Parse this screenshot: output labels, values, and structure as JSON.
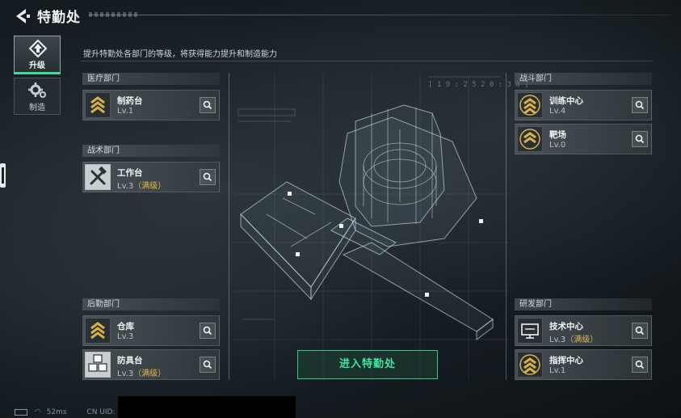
{
  "header": {
    "title": "特勤处",
    "back_icon": "back-arrow-icon"
  },
  "tabs": [
    {
      "label": "升级",
      "icon": "upgrade-icon",
      "active": true
    },
    {
      "label": "制造",
      "icon": "gear-icon",
      "active": false
    }
  ],
  "description": "提升特勤处各部门的等级，将获得能力提升和制造能力",
  "departments": {
    "medical": {
      "title": "医疗部门",
      "items": [
        {
          "name": "制药台",
          "level": "Lv.1",
          "max": "",
          "icon": "chevron-rank-icon"
        }
      ]
    },
    "tactical": {
      "title": "战术部门",
      "items": [
        {
          "name": "工作台",
          "level": "Lv.3",
          "max": "（满级）",
          "icon": "tools-icon"
        }
      ]
    },
    "logistics": {
      "title": "后勤部门",
      "items": [
        {
          "name": "仓库",
          "level": "Lv.3",
          "max": "",
          "icon": "chevron-rank-icon"
        },
        {
          "name": "防具台",
          "level": "Lv.3",
          "max": "（满级）",
          "icon": "cubes-icon"
        }
      ]
    },
    "combat": {
      "title": "战斗部门",
      "items": [
        {
          "name": "训练中心",
          "level": "Lv.4",
          "max": "",
          "icon": "chevron-rank-icon"
        },
        {
          "name": "靶场",
          "level": "Lv.0",
          "max": "",
          "icon": "chevron-rank-icon"
        }
      ]
    },
    "research": {
      "title": "研发部门",
      "items": [
        {
          "name": "技术中心",
          "level": "Lv.3",
          "max": "（满级）",
          "icon": "monitor-icon"
        },
        {
          "name": "指挥中心",
          "level": "Lv.1",
          "max": "",
          "icon": "chevron-rank-icon"
        }
      ]
    }
  },
  "enter_button": "进入特勤处",
  "status": {
    "ping": "52ms",
    "uid_label": "CN UID:"
  },
  "hud_text": {
    "clock": "[ 1 9 : 2 5   2 0 : 3 8 ]"
  },
  "colors": {
    "accent": "#3ddc97",
    "max_level": "#e2b84a",
    "rank_gold": "#d8b14a"
  }
}
